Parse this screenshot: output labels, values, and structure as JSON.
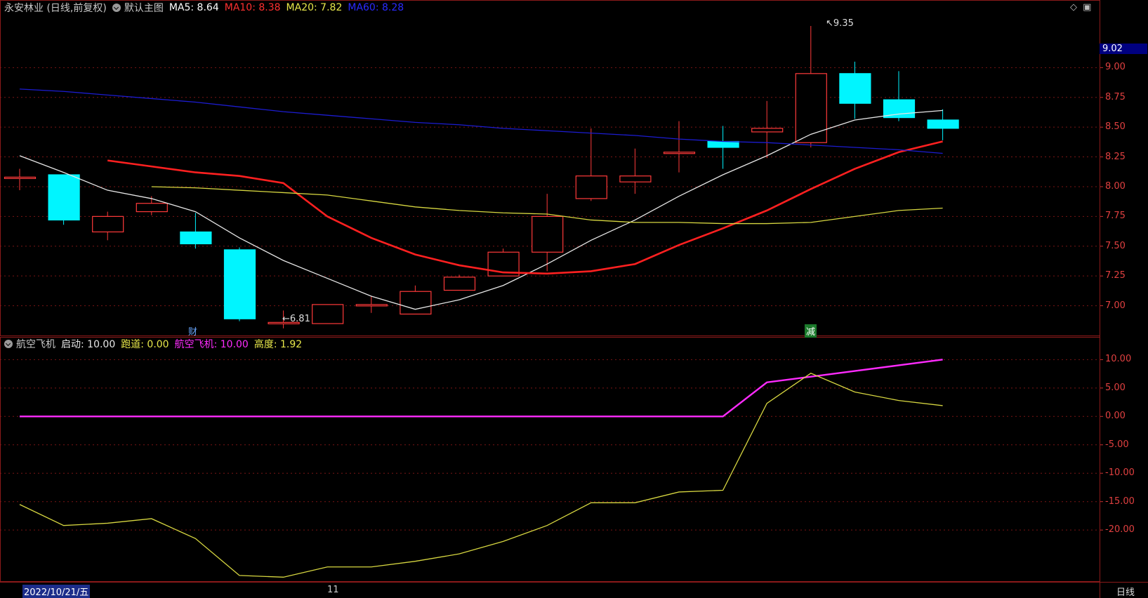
{
  "header": {
    "title": "永安林业 (日线,前复权)",
    "main_chart_label": "默认主图",
    "ma5": "MA5: 8.64",
    "ma10": "MA10: 8.38",
    "ma20": "MA20: 7.82",
    "ma60": "MA60: 8.28",
    "colors": {
      "title": "#c8c8c8",
      "ma5": "#ffffff",
      "ma10": "#ff3030",
      "ma20": "#e8e84a",
      "ma60": "#2a2aff"
    }
  },
  "top_icons": {
    "diamond": "◇",
    "square": "▣"
  },
  "indicator_header": {
    "name": "航空飞机",
    "start": "启动: 10.00",
    "runway": "跑道: 0.00",
    "plane": "航空飞机: 10.00",
    "height": "高度: 1.92",
    "colors": {
      "name": "#c8c8c8",
      "start": "#e8e8e8",
      "runway": "#e8e84a",
      "plane": "#ff2bff",
      "height": "#e8e84a"
    }
  },
  "right_axis_main": {
    "current_price": "9.02",
    "ticks": [
      "9.00",
      "8.75",
      "8.50",
      "8.25",
      "8.00",
      "7.75",
      "7.50",
      "7.25",
      "7.00"
    ]
  },
  "right_axis_indicator": {
    "ticks": [
      "10.00",
      "5.00",
      "0.00",
      "-5.00",
      "-10.00",
      "-15.00",
      "-20.00"
    ]
  },
  "annotations": {
    "high": "9.35",
    "low": "6.81",
    "marker_cai": "财",
    "marker_jian": "减"
  },
  "bottom": {
    "date": "2022/10/21/五",
    "month": "11",
    "period": "日线"
  },
  "chart_data": [
    {
      "type": "candlestick",
      "price_range": [
        6.75,
        9.45
      ],
      "candles": [
        {
          "o": 8.08,
          "c": 8.08,
          "h": 8.15,
          "l": 7.97
        },
        {
          "o": 8.1,
          "c": 7.72,
          "h": 8.1,
          "l": 7.68
        },
        {
          "o": 7.62,
          "c": 7.75,
          "h": 7.79,
          "l": 7.55
        },
        {
          "o": 7.79,
          "c": 7.86,
          "h": 7.92,
          "l": 7.76
        },
        {
          "o": 7.62,
          "c": 7.52,
          "h": 7.78,
          "l": 7.48
        },
        {
          "o": 7.47,
          "c": 6.89,
          "h": 7.49,
          "l": 6.87
        },
        {
          "o": 6.85,
          "c": 6.86,
          "h": 6.96,
          "l": 6.81
        },
        {
          "o": 6.85,
          "c": 7.01,
          "h": 7.01,
          "l": 6.85
        },
        {
          "o": 7.0,
          "c": 7.01,
          "h": 7.08,
          "l": 6.94
        },
        {
          "o": 6.93,
          "c": 7.12,
          "h": 7.17,
          "l": 6.93
        },
        {
          "o": 7.13,
          "c": 7.24,
          "h": 7.26,
          "l": 7.13
        },
        {
          "o": 7.25,
          "c": 7.45,
          "h": 7.48,
          "l": 7.25
        },
        {
          "o": 7.45,
          "c": 7.75,
          "h": 7.94,
          "l": 7.29
        },
        {
          "o": 7.9,
          "c": 8.09,
          "h": 8.49,
          "l": 7.88
        },
        {
          "o": 8.04,
          "c": 8.09,
          "h": 8.32,
          "l": 7.94
        },
        {
          "o": 8.29,
          "c": 8.29,
          "h": 8.55,
          "l": 8.12
        },
        {
          "o": 8.38,
          "c": 8.33,
          "h": 8.51,
          "l": 8.15
        },
        {
          "o": 8.46,
          "c": 8.49,
          "h": 8.72,
          "l": 8.24
        },
        {
          "o": 8.37,
          "c": 8.95,
          "h": 9.35,
          "l": 8.33
        },
        {
          "o": 8.95,
          "c": 8.7,
          "h": 9.05,
          "l": 8.57
        },
        {
          "o": 8.73,
          "c": 8.58,
          "h": 8.97,
          "l": 8.55
        },
        {
          "o": 8.56,
          "c": 8.49,
          "h": 8.65,
          "l": 8.39
        }
      ],
      "series": [
        {
          "name": "MA5",
          "color": "#e6e6e6",
          "values": [
            8.26,
            8.12,
            7.97,
            7.9,
            7.79,
            7.57,
            7.38,
            7.23,
            7.08,
            6.97,
            7.05,
            7.17,
            7.35,
            7.55,
            7.72,
            7.92,
            8.1,
            8.26,
            8.44,
            8.56,
            8.61,
            8.64
          ]
        },
        {
          "name": "MA10",
          "color": "#ff2020",
          "values": [
            8.22,
            8.17,
            8.12,
            8.09,
            8.03,
            7.75,
            7.57,
            7.43,
            7.34,
            7.28,
            7.27,
            7.29,
            7.35,
            7.51,
            7.65,
            7.8,
            7.98,
            8.15,
            8.29,
            8.38
          ]
        },
        {
          "name": "MA20",
          "color": "#d6d640",
          "values": [
            8.0,
            7.99,
            7.97,
            7.95,
            7.93,
            7.88,
            7.83,
            7.8,
            7.78,
            7.77,
            7.72,
            7.7,
            7.7,
            7.69,
            7.69,
            7.7,
            7.75,
            7.8,
            7.82
          ]
        },
        {
          "name": "MA60",
          "color": "#1c1cd0",
          "values": [
            8.82,
            8.8,
            8.77,
            8.74,
            8.71,
            8.67,
            8.63,
            8.6,
            8.57,
            8.54,
            8.52,
            8.49,
            8.47,
            8.45,
            8.43,
            8.4,
            8.38,
            8.37,
            8.35,
            8.33,
            8.31,
            8.28
          ]
        }
      ]
    },
    {
      "type": "line",
      "y_range": [
        -29,
        14
      ],
      "series": [
        {
          "name": "航空飞机",
          "color": "#ff2bff",
          "values": [
            0,
            0,
            0,
            0,
            0,
            0,
            0,
            0,
            0,
            0,
            0,
            0,
            0,
            0,
            0,
            0,
            0,
            6.0,
            7.0,
            8.0,
            9.0,
            10.0
          ]
        },
        {
          "name": "高度",
          "color": "#d6d640",
          "values": [
            -15.5,
            -19.2,
            -18.8,
            -18.0,
            -21.5,
            -28.0,
            -28.3,
            -26.5,
            -26.5,
            -25.5,
            -24.2,
            -22.0,
            -19.2,
            -15.2,
            -15.2,
            -13.3,
            -13.0,
            2.3,
            7.6,
            4.3,
            2.8,
            1.9
          ]
        }
      ]
    }
  ]
}
